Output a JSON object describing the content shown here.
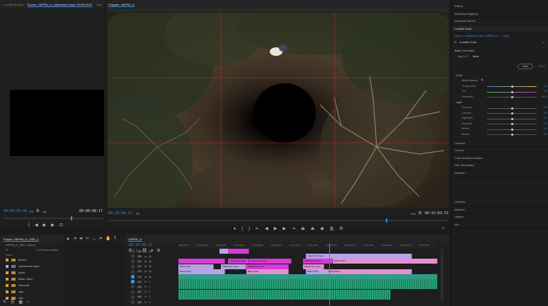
{
  "colors": {
    "accent": "#2d8ceb",
    "clip_magenta": "#d63ad6",
    "clip_lavender": "#b8a2e8",
    "clip_pink": "#e58fd0",
    "clip_teal": "#2f9b86",
    "clip_audio": "#1f8f6a",
    "grid": "#c0392b"
  },
  "source_panel": {
    "tabs": [
      "Lumetri Scopes",
      "Source: 1MPR8_v1_Adjustment Layer: 00:00:33:01",
      "Audi"
    ],
    "timecode_left": "00:59:04:04",
    "fit": "Fit",
    "resolution": "1/4",
    "timecode_right": "00:00:08:17"
  },
  "program_panel": {
    "tab": "Program: 1MPR8_v1",
    "timecode_left": "00:10:48:13",
    "fit": "Fit",
    "resolution": "Full",
    "timecode_right": "00:13:03:13"
  },
  "right_panel": {
    "top_items": [
      "Effects",
      "Essential Graphics",
      "Essential Sound",
      "Lumetri Color"
    ],
    "lumetri_header": "Lumetri Color",
    "source_line": "Source • Adjustment Layer",
    "source_line2": "1MPR8_v1 • ... Layer",
    "fx_label": "fx",
    "preset_label": "Lumetri Color",
    "section_basic": "Basic Correction",
    "input_lut_label": "Input LUT",
    "input_lut_value": "None",
    "auto_button": "Auto",
    "reset_button": "Reset",
    "color_section": "Color",
    "white_balance": "White Balance",
    "rows_color": [
      {
        "label": "Temperature",
        "value": "0.0",
        "pos": 0.5
      },
      {
        "label": "Tint",
        "value": "0.0",
        "pos": 0.5
      },
      {
        "label": "Saturation",
        "value": "100.0",
        "pos": 0.5
      }
    ],
    "light_section": "Light",
    "rows_light": [
      {
        "label": "Exposure",
        "value": "0.0",
        "pos": 0.5
      },
      {
        "label": "Contrast",
        "value": "0.0",
        "pos": 0.5
      },
      {
        "label": "Highlights",
        "value": "0.0",
        "pos": 0.5
      },
      {
        "label": "Shadows",
        "value": "0.0",
        "pos": 0.5
      },
      {
        "label": "Whites",
        "value": "0.0",
        "pos": 0.5
      },
      {
        "label": "Blacks",
        "value": "0.0",
        "pos": 0.5
      }
    ],
    "sections": [
      "Creative",
      "Curves",
      "Color Wheels & Match",
      "HSL Secondary",
      "Vignette"
    ],
    "bottom_items": [
      "Libraries",
      "Markers",
      "History",
      "Info"
    ]
  },
  "project_panel": {
    "tab": "Project: 1MPR8_v1_RED_1",
    "file": "1MPR8_v1_RED_1.prproj",
    "search_placeholder": "",
    "count": "1 of 6 items selected",
    "name_header": "Name",
    "items": [
      {
        "name": "photos",
        "color": "#e0a030"
      },
      {
        "name": "Adjustment Layer",
        "color": "#b8a2e8"
      },
      {
        "name": "audio",
        "color": "#e0a030"
      },
      {
        "name": "Black Video",
        "color": "#e0a030"
      },
      {
        "name": "elements",
        "color": "#e0a030"
      },
      {
        "name": "logo",
        "color": "#e0a030"
      },
      {
        "name": "vids",
        "color": "#e0a030"
      }
    ]
  },
  "timeline_panel": {
    "tab": "1MPR8_v1",
    "timecode": "00:10:48:13",
    "ruler": [
      "00:10:00:00",
      "00:10:15:00",
      "00:10:30:00",
      "00:10:45:00",
      "00:11:00:00",
      "00:11:15:00",
      "00:11:30:00",
      "00:11:45:00",
      "00:12:00:00",
      "00:12:15:00",
      "00:12:30:00",
      "00:12:45:00",
      "00:13:00:00",
      "00:13:15:00"
    ],
    "video_tracks": [
      "V6",
      "V5",
      "V4",
      "V3",
      "V2",
      "V1"
    ],
    "audio_tracks": [
      "A1",
      "A2",
      "A3",
      "A4",
      "A5"
    ],
    "clips": [
      {
        "label": "",
        "color": "#b8a2e8"
      },
      {
        "label": "",
        "color": "#d63ad6"
      },
      {
        "label": "Adjustment Layer",
        "color": "#b8a2e8"
      },
      {
        "label": "",
        "color": "#d63ad6"
      },
      {
        "label": "Adjustment Layer",
        "color": "#d63ad6"
      },
      {
        "label": "Adjustment Layer",
        "color": "#d63ad6"
      },
      {
        "label": "Adjustment Layer",
        "color": "#d63ad6"
      },
      {
        "label": "Black Video",
        "color": "#e58fd0"
      },
      {
        "label": "Black Video",
        "color": "#b8a2e8"
      },
      {
        "label": "Adjustment Layer",
        "color": "#b8a2e8"
      },
      {
        "label": "Adjustment Layer",
        "color": "#d63ad6"
      },
      {
        "label": "Adjustment Layer",
        "color": "#e58fd0"
      },
      {
        "label": "Black Video",
        "color": "#b8a2e8"
      },
      {
        "label": "Black Video",
        "color": "#e58fd0"
      },
      {
        "label": "Black Video",
        "color": "#b8a2e8"
      },
      {
        "label": "Black Video",
        "color": "#e58fd0"
      }
    ]
  }
}
